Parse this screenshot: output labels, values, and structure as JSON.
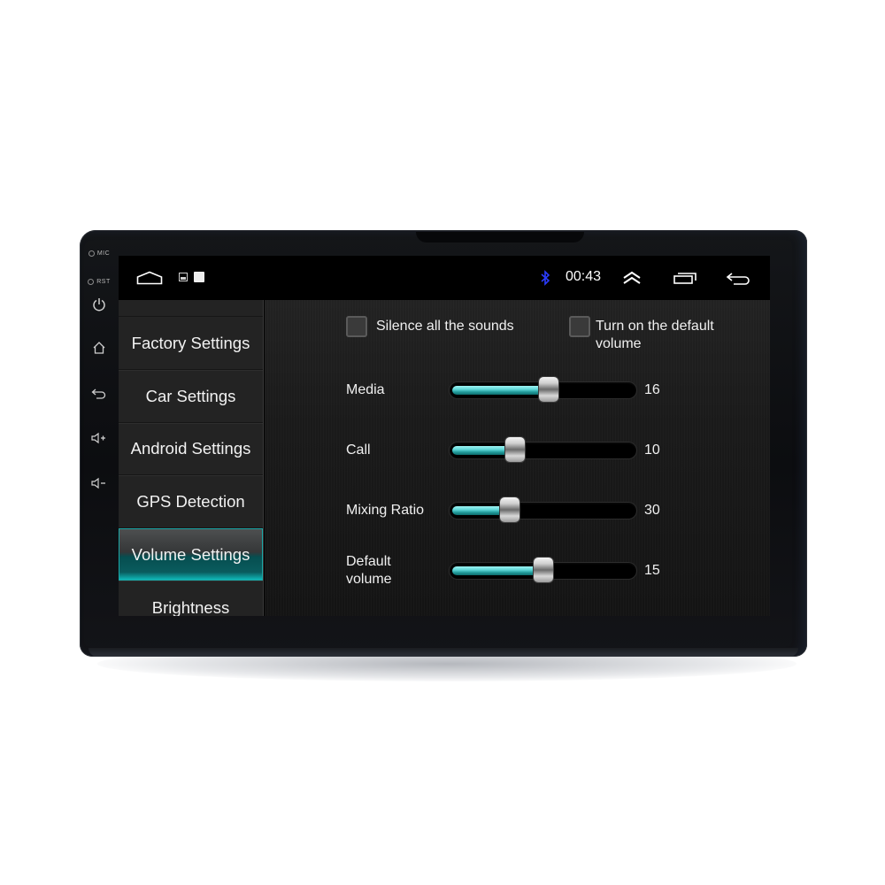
{
  "device": {
    "hardware_buttons": [
      {
        "name": "mic",
        "label": "MIC"
      },
      {
        "name": "rst",
        "label": "RST"
      },
      {
        "name": "power",
        "icon": "power-icon"
      },
      {
        "name": "home",
        "icon": "home-icon"
      },
      {
        "name": "back",
        "icon": "back-icon"
      },
      {
        "name": "volume-up",
        "icon": "volume-up-icon"
      },
      {
        "name": "volume-down",
        "icon": "volume-down-icon"
      }
    ]
  },
  "statusbar": {
    "left_icons": [
      "home-outline-icon",
      "image-notification-icon",
      "white-square-notification-icon"
    ],
    "bluetooth_icon": "bluetooth-icon",
    "bluetooth_color": "#2b3cff",
    "time": "00:43",
    "right_icons": [
      "chevron-double-up-icon",
      "recent-apps-icon",
      "back-arrow-icon"
    ]
  },
  "sidebar": {
    "items": [
      {
        "label": "Factory Settings",
        "active": false
      },
      {
        "label": "Car Settings",
        "active": false
      },
      {
        "label": "Android Settings",
        "active": false
      },
      {
        "label": "GPS Detection",
        "active": false
      },
      {
        "label": "Volume Settings",
        "active": true
      },
      {
        "label": "Brightness",
        "active": false
      }
    ],
    "accent_color": "#1aa7a6"
  },
  "volume_settings": {
    "checkboxes": [
      {
        "label": "Silence all the sounds",
        "checked": false
      },
      {
        "label": "Turn on the default volume",
        "checked": false
      }
    ],
    "sliders": [
      {
        "label": "Media",
        "value": "16",
        "fill_fraction": 0.53
      },
      {
        "label": "Call",
        "value": "10",
        "fill_fraction": 0.35
      },
      {
        "label": "Mixing Ratio",
        "value": "30",
        "fill_fraction": 0.32
      },
      {
        "label": "Default volume",
        "value": "15",
        "fill_fraction": 0.5
      }
    ],
    "slider_fill_color": "#5fd6d6"
  }
}
